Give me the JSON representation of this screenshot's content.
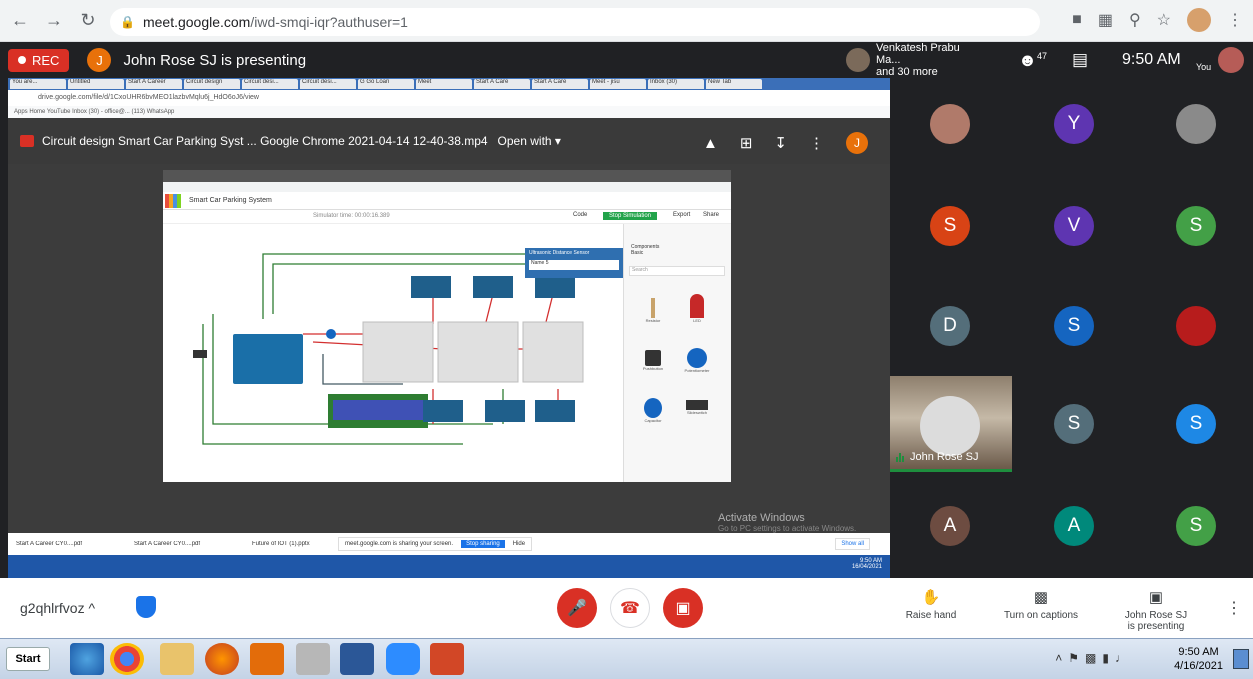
{
  "browser": {
    "url_host": "meet.google.com",
    "url_path": "/iwd-smqi-iqr?authuser=1"
  },
  "presenting_bar": {
    "rec_label": "REC",
    "avatar_letter": "J",
    "presenting_text": "John Rose SJ is presenting"
  },
  "top_right": {
    "names_line1": "Venkatesh Prabu Ma...",
    "names_line2": "and 30 more",
    "people_count": "47",
    "time": "9:50 AM",
    "you_label": "You"
  },
  "shared_screen": {
    "inner_url": "drive.google.com/file/d/1CxoUHR6bvMEO1lazbvMqlu6j_HdO6oJ6/view",
    "inner_bookmarks": "Apps   Home   YouTube   Inbox (30) - office@...   (113) WhatsApp",
    "drive_title": "Circuit design Smart Car Parking Syst ... Google Chrome 2021-04-14 12-40-38.mp4",
    "open_with": "Open with ▾",
    "drive_avatar": "J",
    "tinkercad": {
      "title": "Smart Car Parking System",
      "sim_time": "Simulator time: 00:00:16.389",
      "code": "Code",
      "stop_sim": "Stop Simulation",
      "export": "Export",
      "share": "Share",
      "popup_title": "Ultrasonic Distance Sensor",
      "popup_field": "Name  5",
      "components_label": "Components",
      "components_value": "Basic",
      "search": "Search",
      "items": [
        "Resistor",
        "LED",
        "Pushbutton",
        "Potentiometer",
        "Capacitor",
        "Slideswitch"
      ]
    },
    "activate_title": "Activate Windows",
    "activate_sub": "Go to PC settings to activate Windows.",
    "downloads": [
      "Start A Career CY0....pdf",
      "Start A Career CY0....pdf",
      "Future of IOT (1).pptx"
    ],
    "share_msg": "meet.google.com is sharing your screen.",
    "stop_sharing": "Stop sharing",
    "hide": "Hide",
    "show_all": "Show all",
    "inner_clock_time": "9:50 AM",
    "inner_clock_date": "16/04/2021"
  },
  "participants": [
    {
      "letter": "Y",
      "color": "#5e35b1"
    },
    {
      "letter": "S",
      "color": "#d84315"
    },
    {
      "letter": "V",
      "color": "#5e35b1"
    },
    {
      "letter": "S",
      "color": "#43a047"
    },
    {
      "letter": "D",
      "color": "#546e7a"
    },
    {
      "letter": "S",
      "color": "#1565c0"
    },
    {
      "letter": "S",
      "color": "#546e7a"
    },
    {
      "letter": "S",
      "color": "#1e88e5"
    },
    {
      "letter": "A",
      "color": "#6d4c41"
    },
    {
      "letter": "A",
      "color": "#00897b"
    },
    {
      "letter": "S",
      "color": "#43a047"
    }
  ],
  "active_speaker": {
    "name": "John Rose SJ"
  },
  "bottom": {
    "meeting_code": "g2qhlrfvoz  ^",
    "raise_hand": "Raise hand",
    "captions": "Turn on captions",
    "presenting_line1": "John Rose SJ",
    "presenting_line2": "is presenting"
  },
  "taskbar": {
    "start": "Start",
    "time": "9:50 AM",
    "date": "4/16/2021"
  },
  "colors": {
    "meet_dark": "#202124",
    "rec_red": "#d93025",
    "end_call_red": "#d93025",
    "speaker_green": "#1e8e3e"
  }
}
